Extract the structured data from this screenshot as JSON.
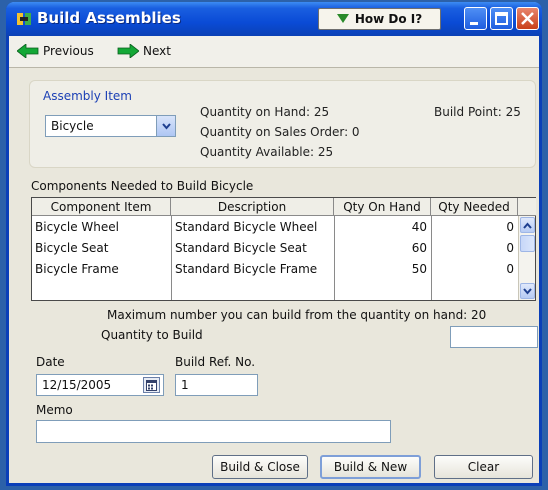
{
  "window": {
    "title": "Build Assemblies",
    "how_do_i": "How Do I?"
  },
  "toolbar": {
    "previous_label": "Previous",
    "next_label": "Next"
  },
  "assembly": {
    "section_label": "Assembly Item",
    "item_value": "Bicycle",
    "qty_on_hand": "Quantity on Hand: 25",
    "qty_on_sales_order": "Quantity on Sales Order: 0",
    "qty_available": "Quantity Available: 25",
    "build_point": "Build Point: 25"
  },
  "components": {
    "label": "Components Needed to Build  Bicycle",
    "columns": [
      "Component Item",
      "Description",
      "Qty On Hand",
      "Qty Needed"
    ],
    "rows": [
      {
        "item": "Bicycle Wheel",
        "description": "Standard Bicycle Wheel",
        "on_hand": "40",
        "needed": "0"
      },
      {
        "item": "Bicycle Seat",
        "description": "Standard Bicycle Seat",
        "on_hand": "60",
        "needed": "0"
      },
      {
        "item": "Bicycle Frame",
        "description": "Standard Bicycle Frame",
        "on_hand": "50",
        "needed": "0"
      }
    ]
  },
  "build": {
    "max_text": "Maximum number you can build from the quantity on hand: 20",
    "qty_to_build_label": "Quantity to Build",
    "qty_to_build_value": ""
  },
  "fields": {
    "date_label": "Date",
    "date_value": "12/15/2005",
    "ref_label": "Build Ref. No.",
    "ref_value": "1",
    "memo_label": "Memo",
    "memo_value": ""
  },
  "buttons": {
    "build_close": "Build & Close",
    "build_new": "Build & New",
    "clear": "Clear"
  },
  "icons": {
    "app": "app-icon",
    "how_do_i": "triangle-down-icon",
    "previous": "arrow-left-icon",
    "next": "arrow-right-icon",
    "calendar": "calendar-icon"
  },
  "colors": {
    "titlebar": "#0a4bd6",
    "section_label": "#1c40b5",
    "close_button": "#c9401a"
  }
}
